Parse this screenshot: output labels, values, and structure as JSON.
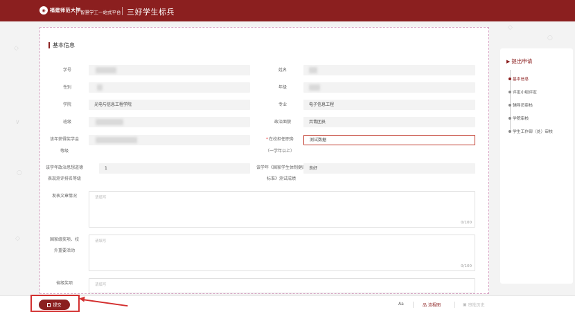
{
  "header": {
    "logo_text": "福建师范大学",
    "platform": "智慧学工一站式平台",
    "app_title": "三好学生标兵"
  },
  "section": {
    "title": "基本信息"
  },
  "fields": {
    "student_id": {
      "label": "学号",
      "value": ""
    },
    "name": {
      "label": "姓名",
      "value": ""
    },
    "gender": {
      "label": "性别",
      "value": ""
    },
    "grade": {
      "label": "年级",
      "value": ""
    },
    "college": {
      "label": "学院",
      "value": "光电与信息工程学院"
    },
    "major": {
      "label": "专业",
      "value": "电子信息工程"
    },
    "class": {
      "label": "班级",
      "value": ""
    },
    "political": {
      "label": "政治面貌",
      "value": "共青团员"
    },
    "scholarship": {
      "label_1": "该年获得奖学金",
      "label_2": "等级",
      "value": ""
    },
    "position": {
      "required_mark": "*",
      "label_1": "在校担任职务",
      "label_2": "（一学年以上）",
      "value": "测试数据"
    },
    "ideology_rank": {
      "label_1": "该学年政治思想道德",
      "label_2": "表现测评排名等级",
      "value": "1"
    },
    "health_score": {
      "label_1": "该学年《国家学生体制健康",
      "label_2": "标准》测试成绩",
      "value": "良好"
    },
    "articles": {
      "label": "发表文章情况",
      "placeholder": "请填写",
      "count": "0/100"
    },
    "national_awards": {
      "label_1": "国家级奖项、校",
      "label_2": "外重要活动",
      "placeholder": "请填写",
      "count": "0/100"
    },
    "provincial_awards": {
      "label": "省级奖项",
      "placeholder": "请填写"
    }
  },
  "sidenav": {
    "title": "提出申请",
    "items": [
      {
        "label": "基本信息",
        "active": true
      },
      {
        "label": "评定小组评定",
        "active": false
      },
      {
        "label": "辅导员审核",
        "active": false
      },
      {
        "label": "学院审核",
        "active": false
      },
      {
        "label": "学生工作部（处）审核",
        "active": false
      }
    ]
  },
  "bottombar": {
    "submit_label": "提交",
    "font_tool": "Aa",
    "flowchart_label": "流程图",
    "history_label": "审批历史"
  },
  "colors": {
    "brand": "#8b1f1f",
    "annotation": "#d32f2f"
  }
}
